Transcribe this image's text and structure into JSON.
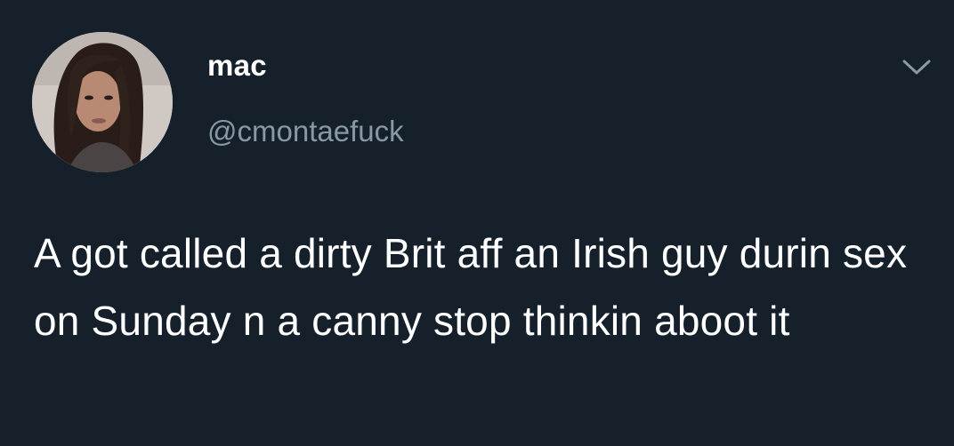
{
  "tweet": {
    "display_name": "mac",
    "handle": "@cmontaefuck",
    "text": "A got called a dirty Brit aff an Irish guy durin sex on Sunday n a canny stop thinkin aboot it",
    "menu_icon": "chevron-down-icon",
    "avatar_icon": "avatar"
  },
  "colors": {
    "background": "#15202b",
    "primary_text": "#ffffff",
    "secondary_text": "#8899a6"
  }
}
